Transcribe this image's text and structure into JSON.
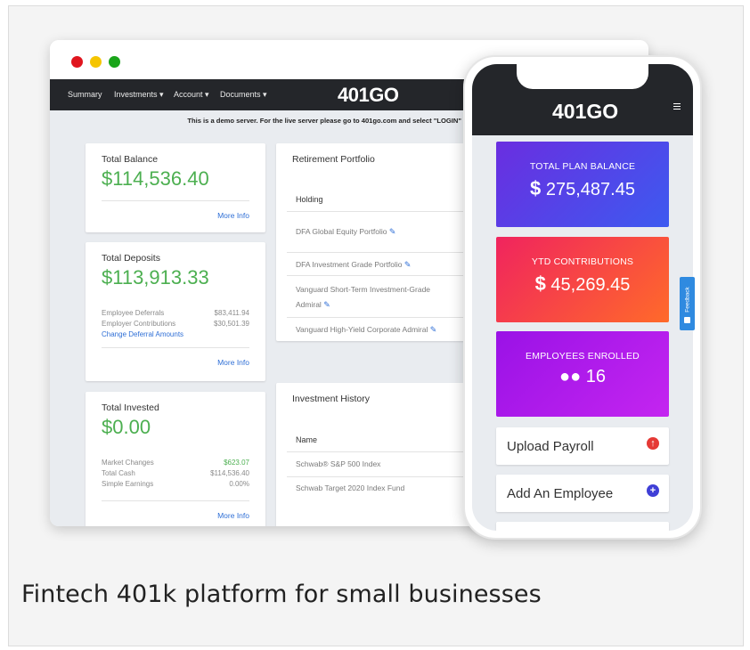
{
  "caption": "Fintech 401k platform for small businesses",
  "colors": {
    "accent_green": "#4caf50",
    "link_blue": "#2f6fd6",
    "nav_dark": "#24262a"
  },
  "desktop": {
    "window_dots": [
      "#e0151e",
      "#f5c500",
      "#1aa51a"
    ],
    "nav": {
      "items": [
        "Summary",
        "Investments ▾",
        "Account ▾",
        "Documents ▾"
      ],
      "logo": "401GO"
    },
    "notice": "This is a demo server. For the live server please go to 401go.com and select \"LOGIN\"",
    "total_balance": {
      "title": "Total Balance",
      "value": "$114,536.40",
      "more": "More Info"
    },
    "total_deposits": {
      "title": "Total Deposits",
      "value": "$113,913.33",
      "rows": [
        {
          "label": "Employee Deferrals",
          "value": "$83,411.94"
        },
        {
          "label": "Employer Contributions",
          "value": "$30,501.39"
        }
      ],
      "link": "Change Deferral Amounts",
      "more": "More Info"
    },
    "total_invested": {
      "title": "Total Invested",
      "value": "$0.00",
      "rows": [
        {
          "label": "Market Changes",
          "value": "$623.07"
        },
        {
          "label": "Total Cash",
          "value": "$114,536.40"
        },
        {
          "label": "Simple Earnings",
          "value": "0.00%"
        }
      ],
      "more": "More Info"
    },
    "retirement_portfolio": {
      "title": "Retirement Portfolio",
      "column": "Holding",
      "holdings": [
        "DFA Global Equity Portfolio",
        "DFA Investment Grade Portfolio",
        "Vanguard Short-Term Investment-Grade",
        "Admiral",
        "Vanguard High-Yield Corporate Admiral"
      ]
    },
    "investment_history": {
      "title": "Investment History",
      "column": "Name",
      "rows": [
        "Schwab® S&P 500 Index",
        "Schwab Target 2020 Index Fund"
      ]
    }
  },
  "phone": {
    "logo": "401GO",
    "stats": [
      {
        "title": "TOTAL PLAN BALANCE",
        "symbol": "$",
        "value": "275,487.45"
      },
      {
        "title": "YTD CONTRIBUTIONS",
        "symbol": "$",
        "value": "45,269.45"
      },
      {
        "title": "EMPLOYEES ENROLLED",
        "symbol": "",
        "value": "16"
      }
    ],
    "actions": [
      {
        "label": "Upload Payroll",
        "color": "#e53935"
      },
      {
        "label": "Add An Employee",
        "color": "#3f3fd6"
      }
    ]
  },
  "feedback_tab": "Feedback"
}
